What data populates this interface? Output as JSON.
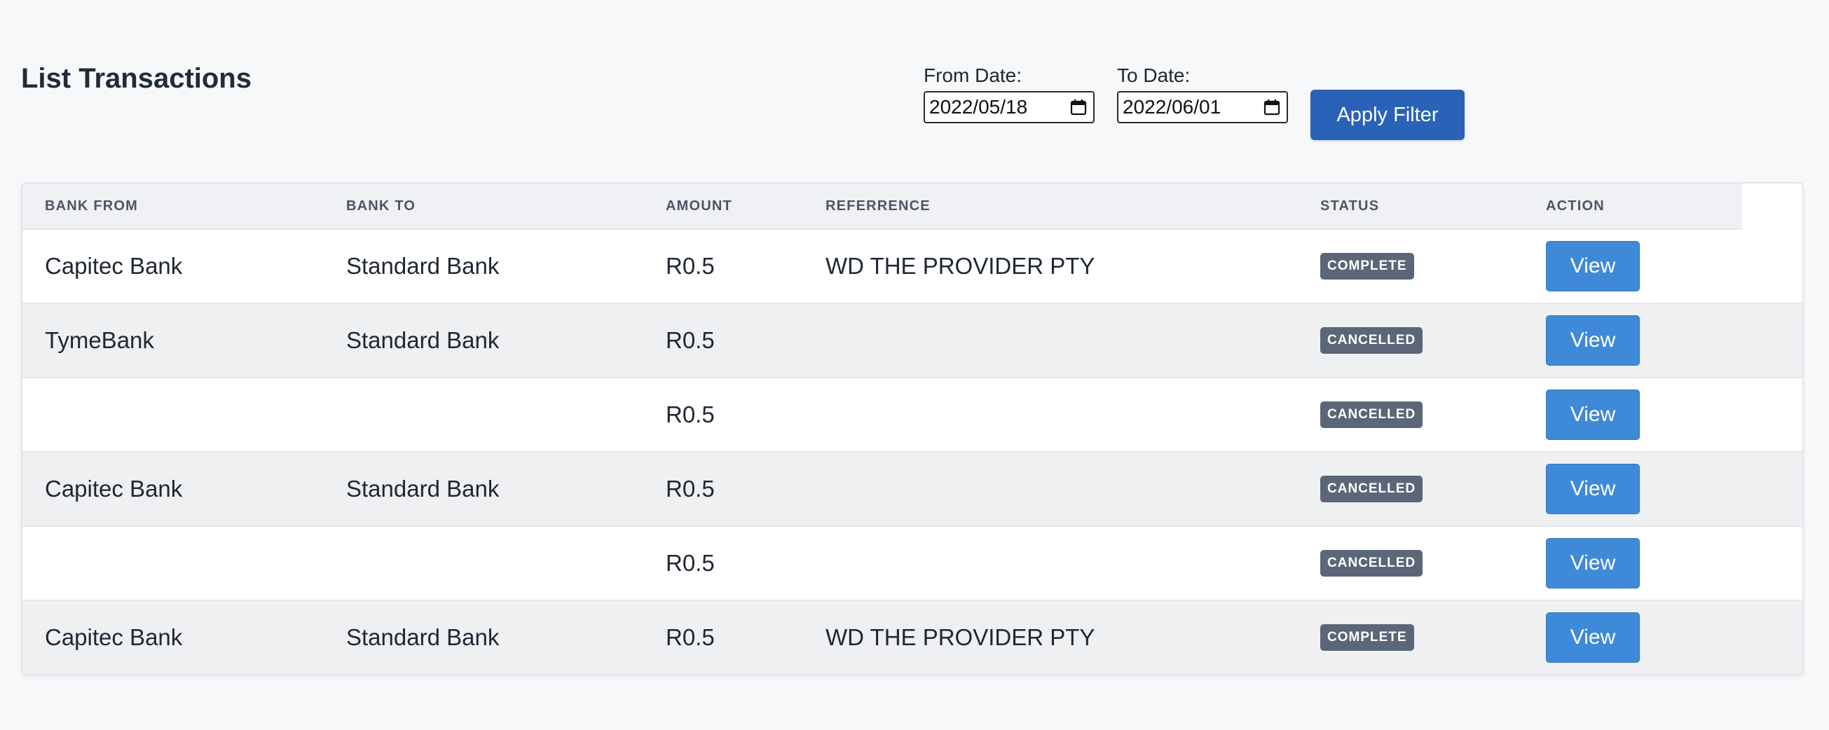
{
  "page": {
    "title": "List Transactions"
  },
  "filters": {
    "from_label": "From Date:",
    "from_value": "2022/05/18",
    "to_label": "To Date:",
    "to_value": "2022/06/01",
    "apply_label": "Apply Filter"
  },
  "table": {
    "headers": [
      "BANK FROM",
      "BANK TO",
      "AMOUNT",
      "REFERRENCE",
      "STATUS",
      "ACTION"
    ],
    "rows": [
      {
        "bank_from": "Capitec Bank",
        "bank_to": "Standard Bank",
        "amount": "R0.5",
        "reference": "WD THE PROVIDER PTY",
        "status": "COMPLETE",
        "action": "View"
      },
      {
        "bank_from": "TymeBank",
        "bank_to": "Standard Bank",
        "amount": "R0.5",
        "reference": "",
        "status": "CANCELLED",
        "action": "View"
      },
      {
        "bank_from": "",
        "bank_to": "",
        "amount": "R0.5",
        "reference": "",
        "status": "CANCELLED",
        "action": "View"
      },
      {
        "bank_from": "Capitec Bank",
        "bank_to": "Standard Bank",
        "amount": "R0.5",
        "reference": "",
        "status": "CANCELLED",
        "action": "View"
      },
      {
        "bank_from": "",
        "bank_to": "",
        "amount": "R0.5",
        "reference": "",
        "status": "CANCELLED",
        "action": "View"
      },
      {
        "bank_from": "Capitec Bank",
        "bank_to": "Standard Bank",
        "amount": "R0.5",
        "reference": "WD THE PROVIDER PTY",
        "status": "COMPLETE",
        "action": "View"
      }
    ]
  },
  "colors": {
    "apply_button": "#2a62b8",
    "view_button": "#3f8ad8",
    "status_badge": "#5b6778"
  },
  "icons": {
    "date_picker": "calendar-icon"
  }
}
